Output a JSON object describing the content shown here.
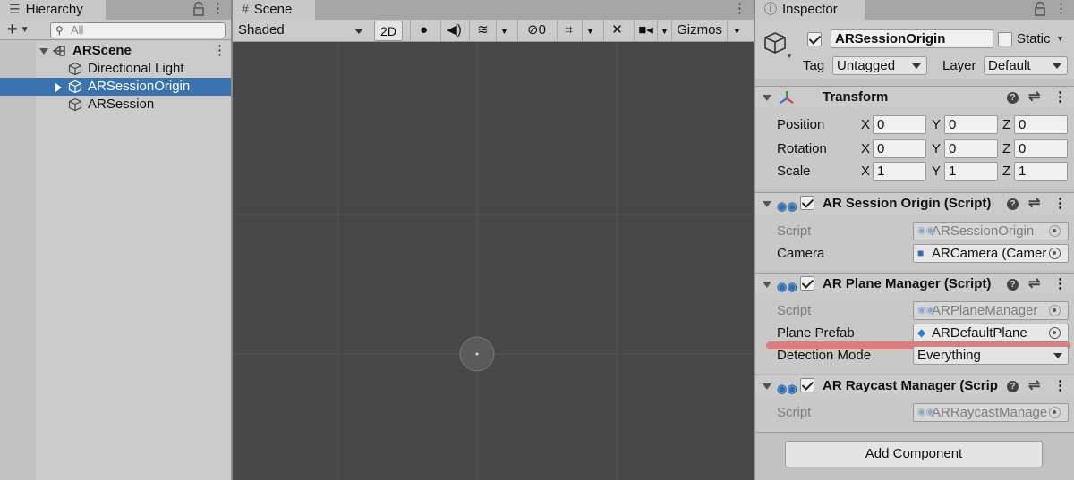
{
  "hierarchy": {
    "tab_label": "Hierarchy",
    "search_placeholder": "All",
    "add_label": "+",
    "scene_name": "ARScene",
    "items": [
      {
        "label": "Directional Light"
      },
      {
        "label": "ARSessionOrigin"
      },
      {
        "label": "ARSession"
      }
    ]
  },
  "scene": {
    "tab_label": "Scene",
    "draw_mode": "Shaded",
    "btn_2d": "2D",
    "hidden_count": "0",
    "gizmos": "Gizmos"
  },
  "inspector": {
    "tab_label": "Inspector",
    "object_name": "ARSessionOrigin",
    "static_label": "Static",
    "tag_label": "Tag",
    "tag_value": "Untagged",
    "layer_label": "Layer",
    "layer_value": "Default",
    "transform": {
      "title": "Transform",
      "position_label": "Position",
      "rotation_label": "Rotation",
      "scale_label": "Scale",
      "x": "X",
      "y": "Y",
      "z": "Z",
      "position": [
        "0",
        "0",
        "0"
      ],
      "rotation": [
        "0",
        "0",
        "0"
      ],
      "scale": [
        "1",
        "1",
        "1"
      ]
    },
    "session_origin": {
      "title": "AR Session Origin (Script)",
      "script_label": "Script",
      "script_value": "ARSessionOrigin",
      "camera_label": "Camera",
      "camera_value": "ARCamera (Camer"
    },
    "plane_manager": {
      "title": "AR Plane Manager (Script)",
      "script_label": "Script",
      "script_value": "ARPlaneManager",
      "prefab_label": "Plane Prefab",
      "prefab_value": "ARDefaultPlane",
      "mode_label": "Detection Mode",
      "mode_value": "Everything"
    },
    "raycast_manager": {
      "title": "AR Raycast Manager (Scrip",
      "script_label": "Script",
      "script_value": "ARRaycastManage"
    },
    "add_component": "Add Component"
  },
  "colors": {
    "selection": "#3a72b0",
    "scene_bg": "#474747",
    "highlight": "#e07070"
  }
}
